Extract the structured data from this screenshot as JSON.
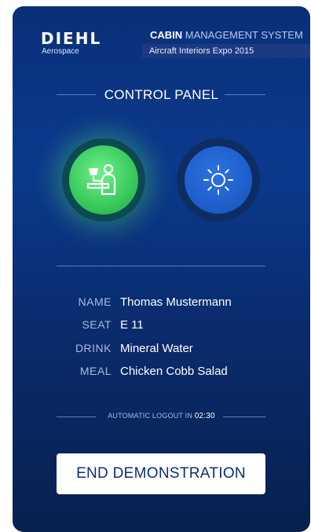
{
  "header": {
    "brand": "DIEHL",
    "brand_sub": "Aerospace",
    "system_bold": "CABIN",
    "system_light": "MANAGEMENT SYSTEM",
    "event": "Aircraft Interiors Expo 2015"
  },
  "control_panel": {
    "title": "CONTROL PANEL",
    "buttons": [
      {
        "name": "attendant-call",
        "icon": "attendant-call-icon",
        "state": "active",
        "color": "#38c95a"
      },
      {
        "name": "reading-light",
        "icon": "sun-icon",
        "state": "inactive",
        "color": "#1f5fcc"
      }
    ]
  },
  "passenger": {
    "rows": [
      {
        "label": "NAME",
        "value": "Thomas Mustermann"
      },
      {
        "label": "SEAT",
        "value": "E 11"
      },
      {
        "label": "DRINK",
        "value": "Mineral Water"
      },
      {
        "label": "MEAL",
        "value": "Chicken Cobb Salad"
      }
    ]
  },
  "logout": {
    "label": "AUTOMATIC LOGOUT IN",
    "time": "02:30"
  },
  "actions": {
    "end_label": "END DEMONSTRATION"
  },
  "colors": {
    "panel_bg": "#0a2f78",
    "accent_green": "#38c95a",
    "accent_blue": "#1f5fcc"
  }
}
